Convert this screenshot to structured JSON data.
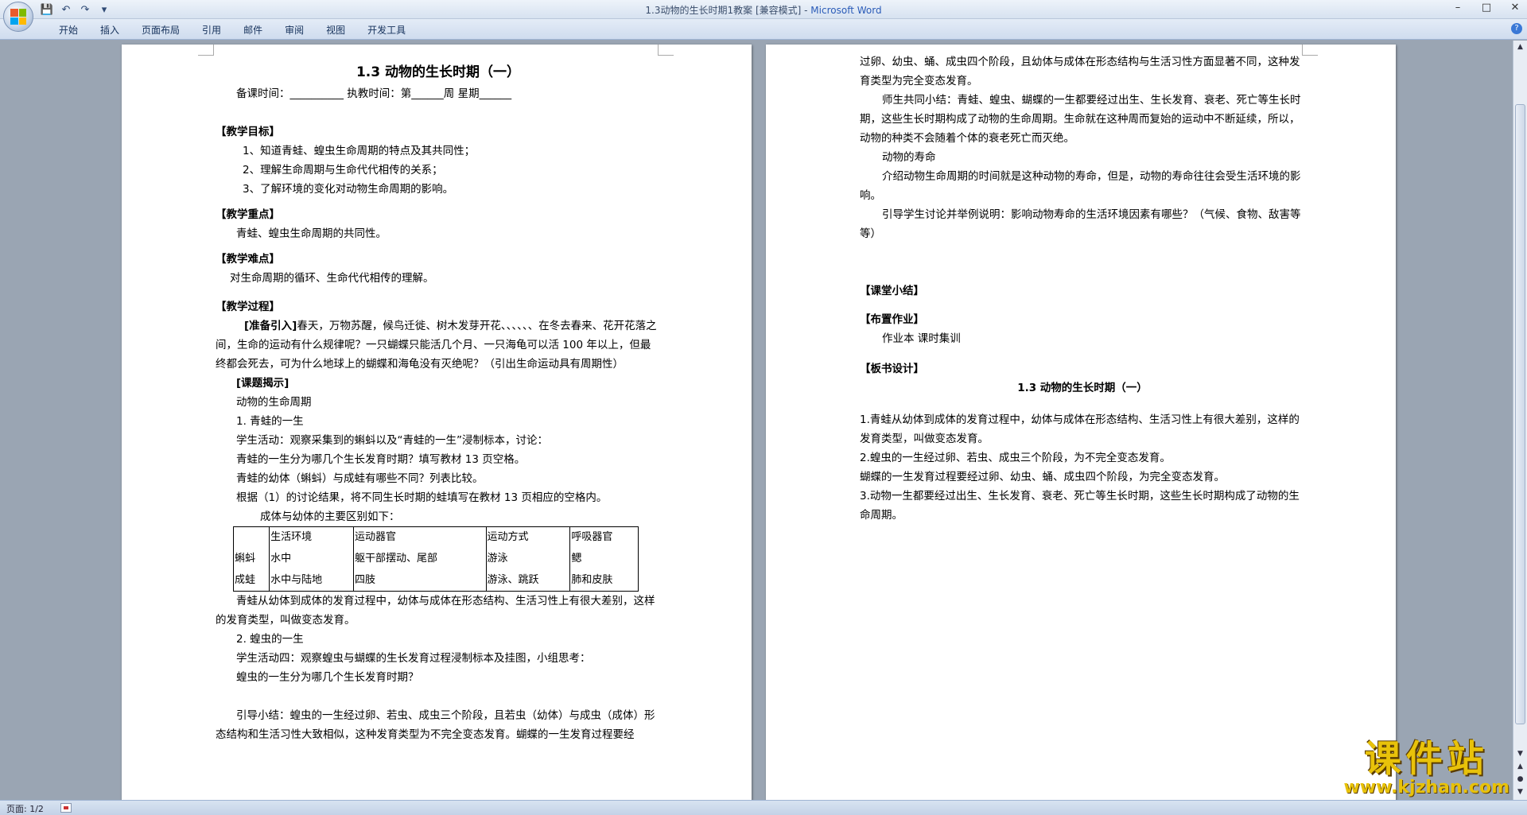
{
  "window": {
    "title": "1.3动物的生长时期1教案 [兼容模式]",
    "app_name": "Microsoft Word",
    "title_separator": " - "
  },
  "ribbon": {
    "tabs": [
      "开始",
      "插入",
      "页面布局",
      "引用",
      "邮件",
      "审阅",
      "视图",
      "开发工具"
    ],
    "help_label": "?"
  },
  "page1": {
    "title": "1.3 动物的生长时期（一）",
    "schedule": "备课时间：__________      执教时间：第______周 星期______",
    "goals_head": "【教学目标】",
    "goals": [
      "1、知道青蛙、蝗虫生命周期的特点及其共同性；",
      "2、理解生命周期与生命代代相传的关系；",
      "3、了解环境的变化对动物生命周期的影响。"
    ],
    "key_head": "【教学重点】",
    "key_text": "青蛙、蝗虫生命周期的共同性。",
    "diff_head": "【教学难点】",
    "diff_text": "对生命周期的循环、生命代代相传的理解。",
    "process_head": "【教学过程】",
    "intro_label": "[准备引入]",
    "intro_text": "春天，万物苏醒，候鸟迁徙、树木发芽开花、、、、、、在冬去春来、花开花落之间，生命的运动有什么规律呢？一只蝴蝶只能活几个月、一只海龟可以活 100 年以上，但最终都会死去，可为什么地球上的蝴蝶和海龟没有灭绝呢？（引出生命运动具有周期性）",
    "topic_label": "[课题揭示]",
    "lines_a": [
      "动物的生命周期",
      "1. 青蛙的一生",
      "学生活动：观察采集到的蝌蚪以及“青蛙的一生”浸制标本，讨论：",
      "青蛙的一生分为哪几个生长发育时期？填写教材 13 页空格。",
      "青蛙的幼体（蝌蚪）与成蛙有哪些不同？列表比较。",
      "根据（1）的讨论结果，将不同生长时期的蛙填写在教材 13 页相应的空格内。"
    ],
    "table_caption": "成体与幼体的主要区别如下：",
    "table": {
      "headers": [
        "",
        "生活环境",
        "运动器官",
        "运动方式",
        "呼吸器官"
      ],
      "rows": [
        [
          "蝌蚪",
          "水中",
          "躯干部摆动、尾部",
          "游泳",
          "鳃"
        ],
        [
          "成蛙",
          "水中与陆地",
          "四肢",
          "游泳、跳跃",
          "肺和皮肤"
        ]
      ]
    },
    "after_table": "青蛙从幼体到成体的发育过程中，幼体与成体在形态结构、生活习性上有很大差别，这样的发育类型，叫做变态发育。",
    "lines_b": [
      "2. 蝗虫的一生",
      "学生活动四：观察蝗虫与蝴蝶的生长发育过程浸制标本及挂图，小组思考：",
      "蝗虫的一生分为哪几个生长发育时期？"
    ],
    "summary_guide": "引导小结：蝗虫的一生经过卵、若虫、成虫三个阶段，且若虫（幼体）与成虫（成体）形态结构和生活习性大致相似，这种发育类型为不完全变态发育。蝴蝶的一生发育过程要经"
  },
  "page2": {
    "cont_text": "过卵、幼虫、蛹、成虫四个阶段，且幼体与成体在形态结构与生活习性方面显著不同，这种发育类型为完全变态发育。",
    "teacher_summary": "师生共同小结：青蛙、蝗虫、蝴蝶的一生都要经过出生、生长发育、衰老、死亡等生长时期，这些生长时期构成了动物的生命周期。生命就在这种周而复始的运动中不断延续，所以，动物的种类不会随着个体的衰老死亡而灭绝。",
    "lifespan_title": "动物的寿命",
    "lifespan_text": "介绍动物生命周期的时间就是这种动物的寿命，但是，动物的寿命往往会受生活环境的影响。",
    "discuss_text": "引导学生讨论并举例说明：影响动物寿命的生活环境因素有哪些？（气候、食物、敌害等等）",
    "class_summary_head": "【课堂小结】",
    "homework_head": "【布置作业】",
    "homework_text": "作业本  课时集训",
    "board_head": "【板书设计】",
    "board_title": "1.3 动物的生长时期（一）",
    "board_items": [
      "1.青蛙从幼体到成体的发育过程中，幼体与成体在形态结构、生活习性上有很大差别，这样的发育类型，叫做变态发育。",
      "2.蝗虫的一生经过卵、若虫、成虫三个阶段，为不完全变态发育。",
      "蝴蝶的一生发育过程要经过卵、幼虫、蛹、成虫四个阶段，为完全变态发育。",
      "3.动物一生都要经过出生、生长发育、衰老、死亡等生长时期，这些生长时期构成了动物的生命周期。"
    ]
  },
  "status": {
    "page": "页面: 1/2"
  },
  "watermark": {
    "name": "课件站",
    "url": "www.kjzhan.com"
  },
  "icons": {
    "save": "save-icon",
    "undo": "undo-icon",
    "redo": "redo-icon",
    "minimize": "minimize-icon",
    "maximize": "maximize-icon",
    "close": "close-icon"
  }
}
